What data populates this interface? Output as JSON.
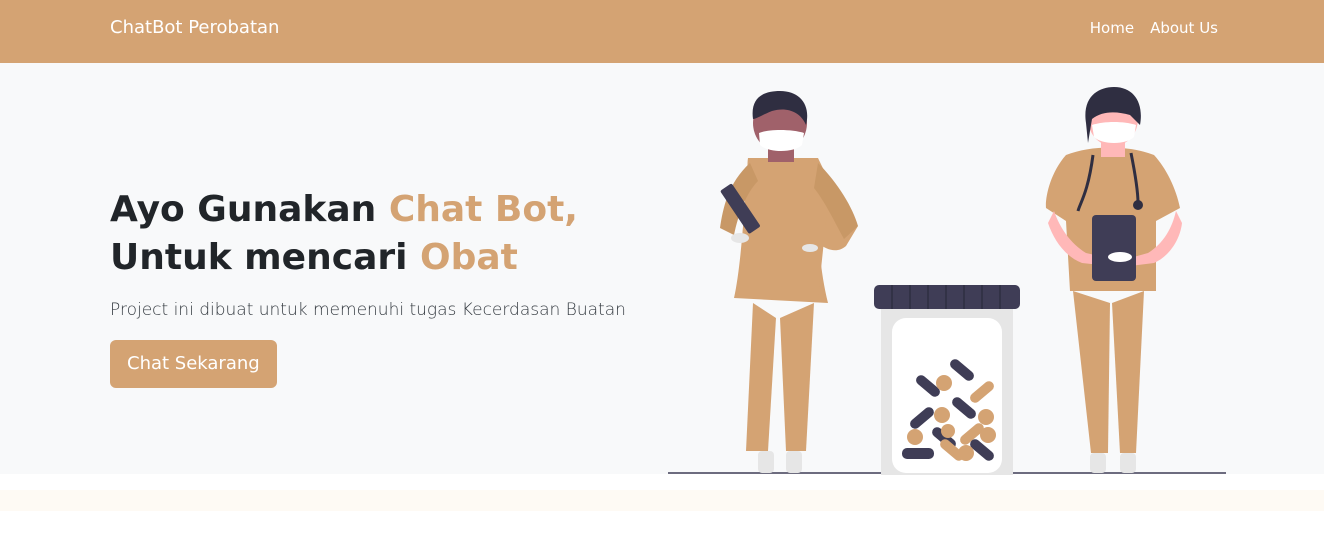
{
  "navbar": {
    "brand": "ChatBot Perobatan",
    "links": [
      {
        "label": "Home"
      },
      {
        "label": "About Us"
      }
    ],
    "background_color": "#d4a373"
  },
  "hero": {
    "headline_part1": "Ayo Gunakan ",
    "headline_accent1": "Chat Bot,",
    "headline_part2": " Untuk mencari ",
    "headline_accent2": "Obat",
    "subtitle": "Project ini dibuat untuk memenuhi tugas Kecerdasan Buatan",
    "cta_label": "Chat Sekarang",
    "accent_color": "#d4a373"
  },
  "illustration": {
    "icon": "doctors-with-medicine-jar-illustration"
  }
}
